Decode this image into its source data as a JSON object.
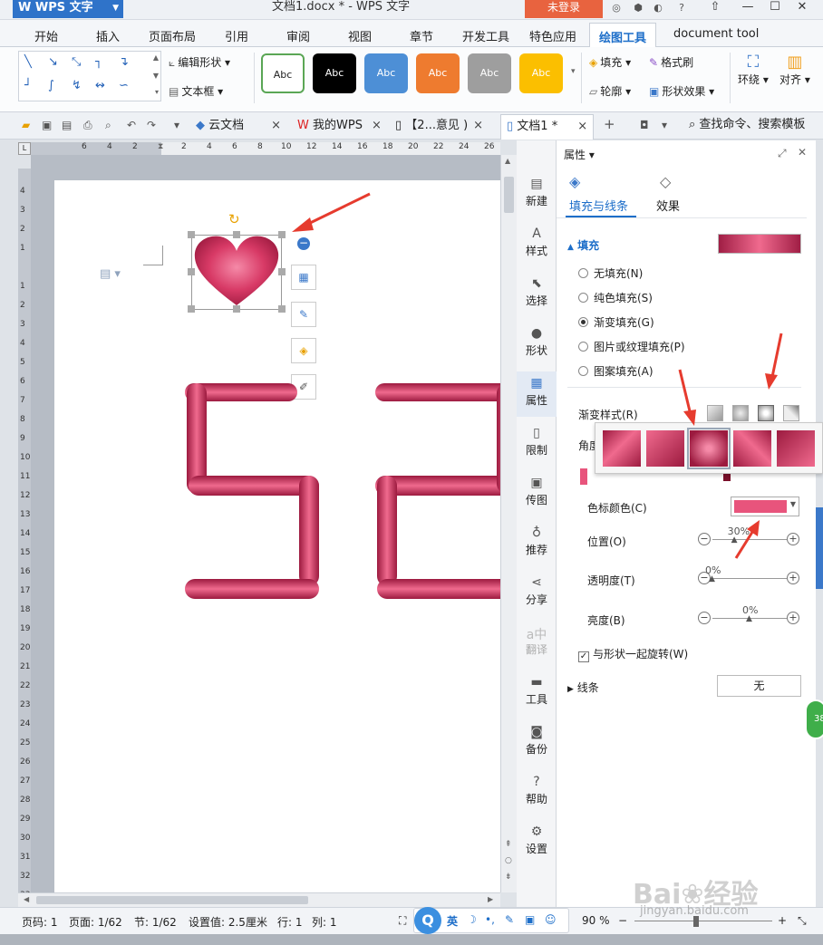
{
  "titlebar": {
    "app_name": "WPS 文字",
    "doc_title": "文档1.docx * - WPS 文字",
    "login_label": "未登录"
  },
  "ribbon_tabs": [
    "开始",
    "插入",
    "页面布局",
    "引用",
    "审阅",
    "视图",
    "章节",
    "开发工具",
    "特色应用",
    "绘图工具",
    "document tool"
  ],
  "ribbon": {
    "edit_shape_label": "编辑形状",
    "text_box_label": "文本框",
    "style_swatch_label": "Abc",
    "fill_label": "填充",
    "format_painter_label": "格式刷",
    "outline_label": "轮廓",
    "shape_effect_label": "形状效果",
    "wrap_label": "环绕",
    "align_label": "对齐"
  },
  "doc_tabs": {
    "cloud": "云文档",
    "mywps": "我的WPS",
    "other": "【2...意见 )",
    "active": "文档1 *",
    "search": "查找命令、搜索模板"
  },
  "ruler": {
    "h_numbers": [
      "6",
      "4",
      "2",
      "",
      "2",
      "4",
      "6",
      "8",
      "10",
      "12",
      "14",
      "16",
      "18",
      "20",
      "22",
      "24",
      "26"
    ],
    "v_numbers": [
      "4",
      "3",
      "2",
      "1",
      "",
      "1",
      "2",
      "3",
      "4",
      "5",
      "6",
      "7",
      "8",
      "9",
      "10",
      "11",
      "12",
      "13",
      "14",
      "15",
      "16",
      "17",
      "18",
      "19",
      "20",
      "21",
      "22",
      "23",
      "24",
      "25",
      "26",
      "27",
      "28",
      "29",
      "30",
      "31",
      "32",
      "33"
    ]
  },
  "sidebar": {
    "items": [
      {
        "label": "新建",
        "icon": "new-doc-icon"
      },
      {
        "label": "样式",
        "icon": "style-icon"
      },
      {
        "label": "选择",
        "icon": "select-icon"
      },
      {
        "label": "形状",
        "icon": "shape-icon"
      },
      {
        "label": "属性",
        "icon": "property-icon"
      },
      {
        "label": "限制",
        "icon": "restrict-icon"
      },
      {
        "label": "传图",
        "icon": "upload-image-icon"
      },
      {
        "label": "推荐",
        "icon": "recommend-icon"
      },
      {
        "label": "分享",
        "icon": "share-icon"
      },
      {
        "label": "翻译",
        "icon": "translate-icon"
      },
      {
        "label": "工具",
        "icon": "toolbox-icon"
      },
      {
        "label": "备份",
        "icon": "backup-icon"
      },
      {
        "label": "帮助",
        "icon": "help-icon"
      },
      {
        "label": "设置",
        "icon": "settings-icon"
      }
    ]
  },
  "panel": {
    "title": "属性",
    "tab_fill_line": "填充与线条",
    "tab_effect": "效果",
    "fill_section": "填充",
    "options": [
      "无填充(N)",
      "纯色填充(S)",
      "渐变填充(G)",
      "图片或纹理填充(P)",
      "图案填充(A)"
    ],
    "selected_option": 2,
    "gradient_style_label": "渐变样式(R)",
    "angle_label_partial": "角度",
    "stop_color_label": "色标颜色(C)",
    "position_label": "位置(O)",
    "position_value": "30%",
    "position_fraction": 0.3,
    "transparency_label": "透明度(T)",
    "transparency_value": "0%",
    "transparency_fraction": 0.0,
    "brightness_label": "亮度(B)",
    "brightness_value": "0%",
    "brightness_fraction": 0.5,
    "rotate_with_shape_label": "与形状一起旋转(W)",
    "line_section": "线条",
    "line_value": "无",
    "minus_label": "−",
    "plus_label": "+"
  },
  "colors": {
    "accent": "#2f73c9",
    "heart_light": "#f06a8e",
    "heart_dark": "#a01e45",
    "stop_color": "#e8547c",
    "arrow": "#e63b2e",
    "login": "#e8633f"
  },
  "status": {
    "page_code": "页码: 1",
    "page": "页面: 1/62",
    "section": "节: 1/62",
    "setting": "设置值: 2.5厘米",
    "row": "行: 1",
    "col": "列: 1",
    "ime": "英",
    "zoom": "90 %",
    "zoom_fraction": 0.9
  },
  "watermark": {
    "brand": "Bai",
    "brand2": "经验",
    "url": "jingyan.baidu.com"
  },
  "badge": "38"
}
